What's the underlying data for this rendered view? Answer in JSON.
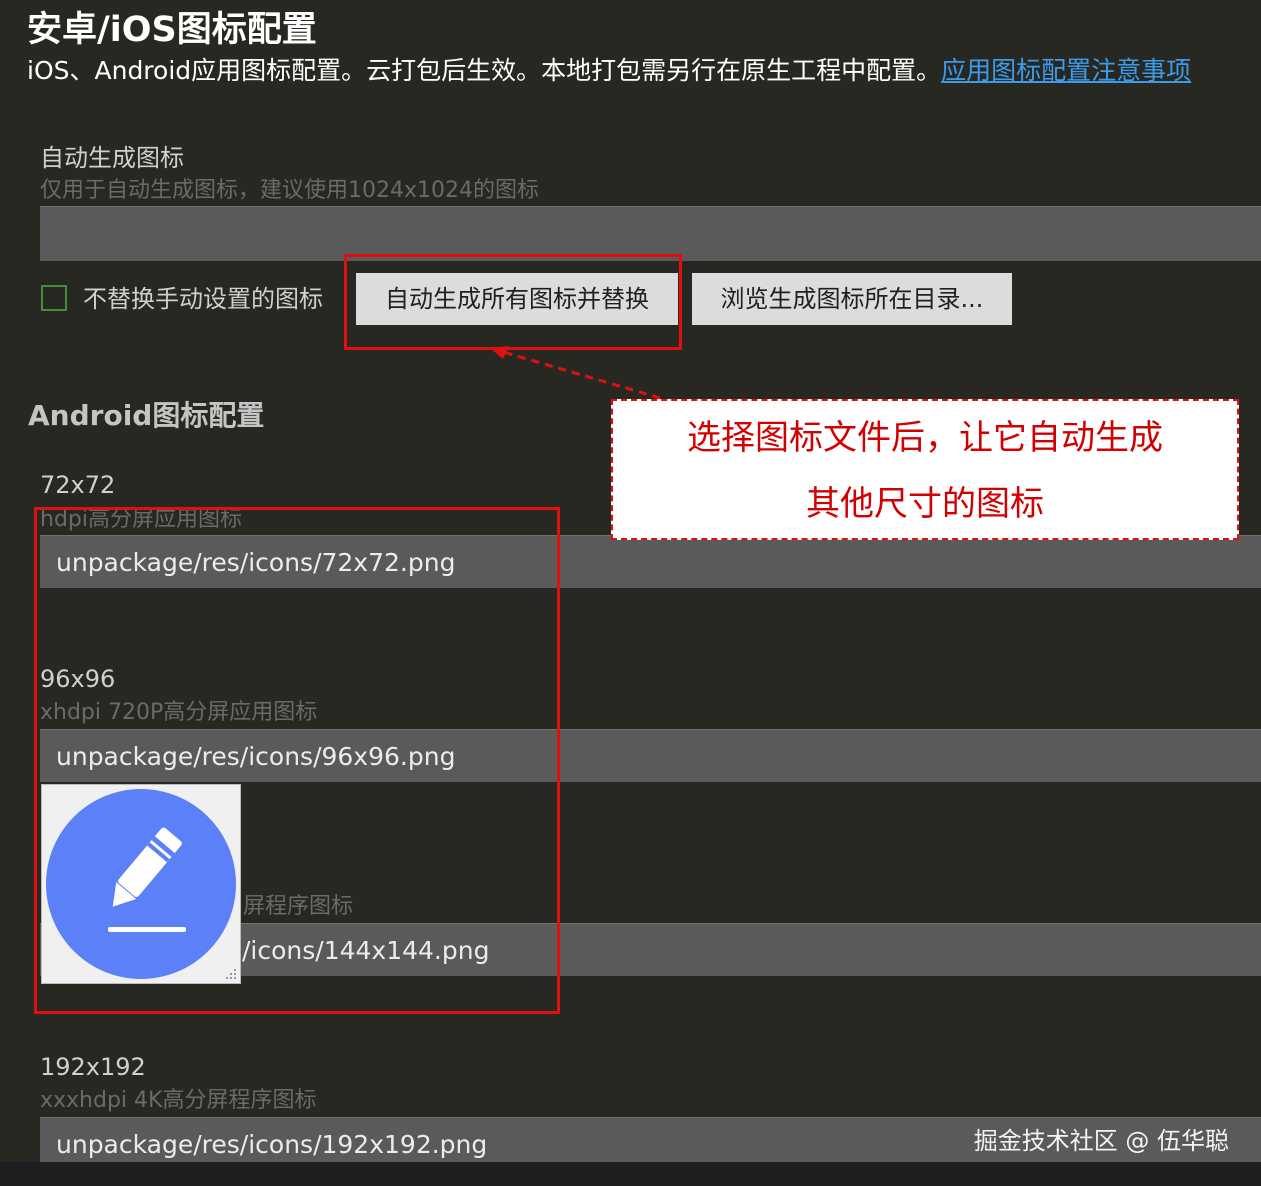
{
  "header": {
    "title": "安卓/iOS图标配置",
    "description": "iOS、Android应用图标配置。云打包后生效。本地打包需另行在原生工程中配置。",
    "link_label": "应用图标配置注意事项"
  },
  "auto_generate": {
    "label": "自动生成图标",
    "hint": "仅用于自动生成图标，建议使用1024x1024的图标",
    "value": "",
    "checkbox_label": "不替换手动设置的图标",
    "generate_button": "自动生成所有图标并替换",
    "browse_button": "浏览生成图标所在目录..."
  },
  "android": {
    "section_title": "Android图标配置",
    "fields": [
      {
        "label": "72x72",
        "hint": "hdpi高分屏应用图标",
        "value": "unpackage/res/icons/72x72.png"
      },
      {
        "label": "96x96",
        "hint": "xhdpi 720P高分屏应用图标",
        "value": "unpackage/res/icons/96x96.png"
      },
      {
        "label": "",
        "hint": "屏程序图标",
        "value": "/icons/144x144.png"
      },
      {
        "label": "192x192",
        "hint": "xxxhdpi 4K高分屏程序图标",
        "value": "unpackage/res/icons/192x192.png"
      }
    ]
  },
  "callout": {
    "line1": "选择图标文件后，让它自动生成",
    "line2": "其他尺寸的图标"
  },
  "preview": {
    "icon": "pencil-icon",
    "colors": {
      "circle": "#5b80f7",
      "glyph": "#ffffff"
    }
  },
  "watermark": "掘金技术社区 @ 伍华聪",
  "colors": {
    "background": "#272822",
    "link": "#3d9bea",
    "annotation": "#e01010",
    "checkbox_border": "#3f8f3f"
  }
}
